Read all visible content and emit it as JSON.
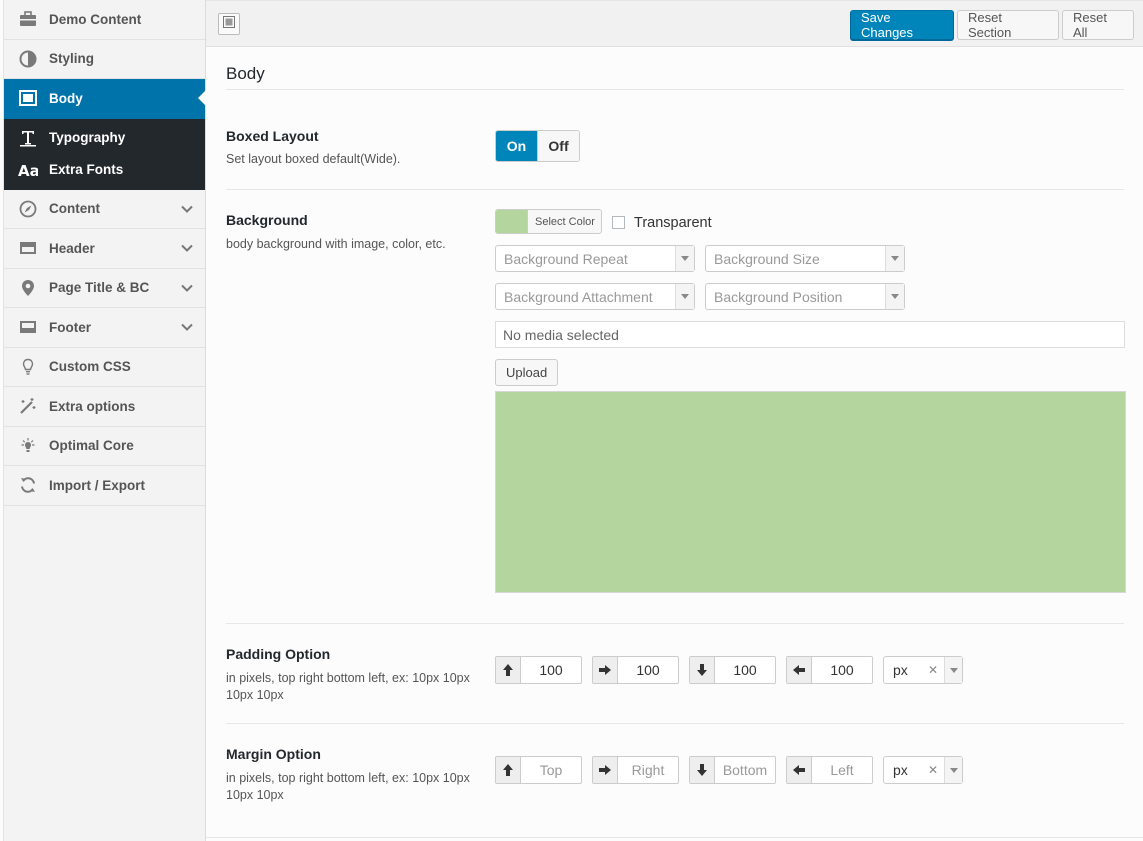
{
  "sidebar": {
    "items": [
      {
        "label": "Demo Content",
        "icon": "briefcase-icon"
      },
      {
        "label": "Styling",
        "icon": "contrast-icon"
      },
      {
        "label": "Body",
        "icon": "body-layout-icon"
      },
      {
        "label": "Content",
        "icon": "compass-icon"
      },
      {
        "label": "Header",
        "icon": "header-bar-icon"
      },
      {
        "label": "Page Title & BC",
        "icon": "map-pin-icon"
      },
      {
        "label": "Footer",
        "icon": "footer-bar-icon"
      },
      {
        "label": "Custom CSS",
        "icon": "lightbulb-icon"
      },
      {
        "label": "Extra options",
        "icon": "magic-wand-icon"
      },
      {
        "label": "Optimal Core",
        "icon": "bulb-glow-icon"
      },
      {
        "label": "Import / Export",
        "icon": "refresh-icon"
      }
    ],
    "subitems": [
      {
        "label": "Typography",
        "icon": "text-format-icon"
      },
      {
        "label": "Extra Fonts",
        "icon": "font-aa-icon"
      }
    ]
  },
  "toolbar": {
    "save_label": "Save Changes",
    "reset_section_label": "Reset Section",
    "reset_all_label": "Reset All"
  },
  "main": {
    "section_title": "Body",
    "boxed": {
      "title": "Boxed Layout",
      "desc": "Set layout boxed default(Wide).",
      "on_label": "On",
      "off_label": "Off",
      "value": "On"
    },
    "background": {
      "title": "Background",
      "desc": "body background with image, color, etc.",
      "color_button": "Select Color",
      "color_value": "#b5d59e",
      "transparent_label": "Transparent",
      "repeat_placeholder": "Background Repeat",
      "size_placeholder": "Background Size",
      "attachment_placeholder": "Background Attachment",
      "position_placeholder": "Background Position",
      "media_placeholder": "No media selected",
      "upload_label": "Upload"
    },
    "padding": {
      "title": "Padding Option",
      "desc": "in pixels, top right bottom left, ex: 10px 10px 10px 10px",
      "top": "100",
      "right": "100",
      "bottom": "100",
      "left": "100",
      "unit": "px"
    },
    "margin": {
      "title": "Margin Option",
      "desc": "in pixels, top right bottom left, ex: 10px 10px 10px 10px",
      "top_placeholder": "Top",
      "right_placeholder": "Right",
      "bottom_placeholder": "Bottom",
      "left_placeholder": "Left",
      "unit": "px"
    }
  },
  "colors": {
    "accent": "#0073aa",
    "primary_button": "#0085ba",
    "submenu_bg": "#23282d",
    "swatch": "#b5d59e"
  }
}
